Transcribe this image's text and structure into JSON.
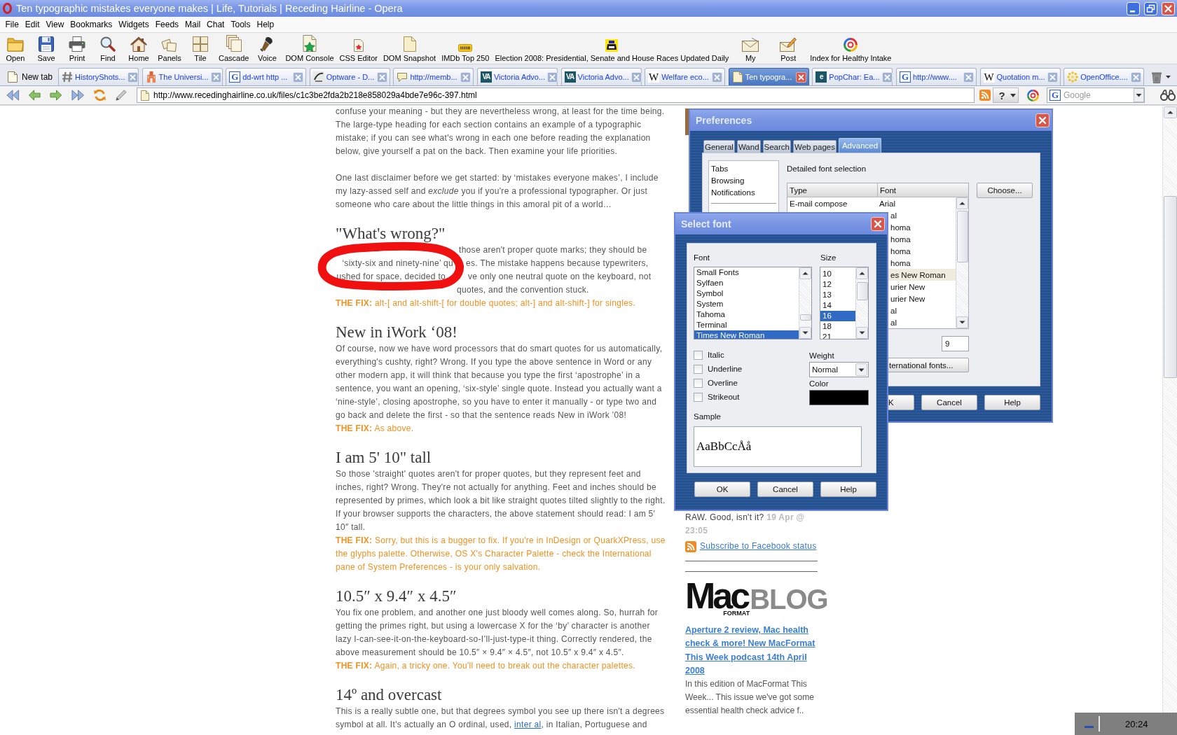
{
  "window": {
    "title": "Ten typographic mistakes everyone makes | Life, Tutorials | Receding Hairline - Opera"
  },
  "menu": [
    "File",
    "Edit",
    "View",
    "Bookmarks",
    "Widgets",
    "Feeds",
    "Mail",
    "Chat",
    "Tools",
    "Help"
  ],
  "toolbar": [
    {
      "label": "Open"
    },
    {
      "label": "Save"
    },
    {
      "label": "Print"
    },
    {
      "label": "Find"
    },
    {
      "label": "Home"
    },
    {
      "label": "Panels"
    },
    {
      "label": "Tile"
    },
    {
      "label": "Cascade"
    },
    {
      "label": "Voice"
    },
    {
      "label": "DOM Console"
    },
    {
      "label": "CSS Editor"
    },
    {
      "label": "DOM Snapshot"
    },
    {
      "label": "IMDb Top 250"
    },
    {
      "label": "Election 2008: Presidential, Senate and House Races Updated Daily"
    },
    {
      "label": "My"
    },
    {
      "label": "Post"
    },
    {
      "label": "Index for Healthy Intake"
    }
  ],
  "tabs": {
    "new_tab": "New tab",
    "items": [
      {
        "label": "HistoryShots...",
        "selected": false
      },
      {
        "label": "The Universi...",
        "selected": false
      },
      {
        "label": "dd-wrt http ...",
        "icon_text": "G",
        "selected": false
      },
      {
        "label": "Optware - D...",
        "selected": false
      },
      {
        "label": "http://memb...",
        "selected": false
      },
      {
        "label": "Victoria Advo...",
        "icon_text": "VA",
        "selected": false
      },
      {
        "label": "Victoria Advo...",
        "icon_text": "VA",
        "selected": false
      },
      {
        "label": "Welfare eco...",
        "icon_text": "W",
        "selected": false
      },
      {
        "label": "Ten typogra...",
        "selected": true
      },
      {
        "label": "PopChar: Ea...",
        "icon_text": "e",
        "selected": false
      },
      {
        "label": "http://www....",
        "icon_text": "G",
        "selected": false
      },
      {
        "label": "Quotation m...",
        "icon_text": "W",
        "selected": false
      },
      {
        "label": "OpenOffice....",
        "selected": false
      }
    ]
  },
  "address_bar": {
    "url": "http://www.recedinghairline.co.uk/files/c1c3be2fda2b218e858029a4bde7e96c-397.html",
    "help_button": "?",
    "search": {
      "engine_letter": "G",
      "placeholder": "Google"
    }
  },
  "article": {
    "intro": "confuse your meaning - but they are nevertheless wrong, at least for the time being. The large-type heading for each section contains an example of a typographic mistake; if you can see what's wrong in each one before reading the explanation below, give yourself a pat on the back. Then examine your life priorities.",
    "disclaimer": "One last disclaimer before we get started: by ‘mistakes everyone makes’, I include my lazy-assed self and *exclude* you if you're a professional typographer. Or just someone who care about the little things in this amoral pit of a world…",
    "sections": [
      {
        "kind": "annotated",
        "heading": "\"What's wrong?\"",
        "body": [
          {
            "kind": "text",
            "text": "those aren't proper quote marks; they should be"
          },
          {
            "kind": "text",
            "text": "‘sixty-six and ninety-nine’ qu"
          },
          {
            "kind": "text",
            "text": "es. The mistake happens because typewriters,"
          },
          {
            "kind": "text",
            "text": "ushed for space, decided to"
          },
          {
            "kind": "text",
            "text": "ve only one neutral quote on the keyboard, not"
          },
          {
            "kind": "text",
            "text": "quotes, and the convention stuck."
          }
        ],
        "fix": "**THE FIX:** alt-[ and alt-shift-[ for double quotes; alt-] and alt-shift-] for singles."
      },
      {
        "kind": "plain",
        "heading": "New in iWork ‘08!",
        "body": [
          {
            "kind": "text",
            "text": "Of course, now we have word processors that do smart quotes for us automatically, everything's cushty, right? Wrong. If you type the above sentence in Word or any other modern app, it will think that because you type the first ‘apostrophe’ in a sentence, you want an opening, ‘six-style’ single quote. Instead you actually want a ‘nine-style’, closing apostrophe, so you have to enter it manually - or type two and go back and delete the first - so that the sentence reads New in iWork ’08!"
          }
        ],
        "fix": "**THE FIX:** As above."
      },
      {
        "kind": "plain",
        "heading": "I am 5' 10\" tall",
        "body": [
          {
            "kind": "text",
            "text": "So those 'straight' quotes aren't for proper quotes, but they represent feet and inches, right? Wrong. They're not actually for anything. Feet and inches should be represented by primes, which look a bit like straight quotes tilted slightly to the right. If your browser supports the characters, the above statement should read: I am 5′ 10″ tall."
          }
        ],
        "fix": "**THE FIX:** Sorry, but this is a bugger to fix. If you're in InDesign or QuarkXPress, use the glyphs palette. Otherwise, OS X's Character Palette - check the International pane of System Preferences - is your only salvation."
      },
      {
        "kind": "plain",
        "heading": "10.5″ x 9.4″ x 4.5″",
        "body": [
          {
            "kind": "text",
            "text": "You fix one problem, and another one just bloody well comes along. So, hurrah for getting the primes right, but using a lowercase X for the ‘by’ character is another lazy I-can-see-it-on-the-keyboard-so-I’ll-just-type-it thing. Correctly rendered, the above measurement should be 10.5″ × 9.4″ × 4.5″, not 10.5″ x 9.4″ x 4.5″."
          }
        ],
        "fix": "**THE FIX:** Again, a tricky one. You'll need to break out the character palettes."
      },
      {
        "kind": "plain",
        "heading": "14º and overcast",
        "body": [
          {
            "kind": "text",
            "text": "This is a really subtle one, but that degrees symbol you see up there isn't a degrees symbol at all. It's actually an O ordinal, used, "
          },
          {
            "kind": "link",
            "text": "inter al"
          },
          {
            "kind": "text",
            "text": ", in Italian, Portuguese and"
          }
        ]
      }
    ]
  },
  "sidebar": {
    "status": "RAW. Good, isn't it? **19 Apr @ 23:05**",
    "subscribe_link": "Subscribe to Facebook status",
    "logo": {
      "main": "Mac",
      "accent": "BLOG",
      "sub": "FORMAT"
    },
    "post": {
      "title": "Aperture 2 review, Mac health check & more! New MacFormat This Week podcast 14th April 2008",
      "summary": "In this edition of MacFormat This Week... This issue we've got some essential health check advice f.."
    }
  },
  "preferences_dialog": {
    "title": "Preferences",
    "tabs": [
      {
        "label": "General",
        "selected": false
      },
      {
        "label": "Wand",
        "selected": false
      },
      {
        "label": "Search",
        "selected": false
      },
      {
        "label": "Web pages",
        "selected": false
      },
      {
        "label": "Advanced",
        "selected": true
      }
    ],
    "categories": [
      "Tabs",
      "Browsing",
      "Notifications"
    ],
    "section_title": "Detailed font selection",
    "columns": [
      "Type",
      "Font"
    ],
    "rows": [
      {
        "type": "E-mail compose",
        "font": "Arial",
        "selected": false
      },
      {
        "font": "al",
        "selected": false
      },
      {
        "font": "homa",
        "selected": false
      },
      {
        "font": "homa",
        "selected": false
      },
      {
        "font": "homa",
        "selected": false
      },
      {
        "font": "homa",
        "selected": false
      },
      {
        "font": "es New Roman",
        "selected": true
      },
      {
        "font": "urier New",
        "selected": false
      },
      {
        "font": "urier New",
        "selected": false
      },
      {
        "font": "al",
        "selected": false
      },
      {
        "font": "al",
        "selected": false
      }
    ],
    "choose_button": "Choose...",
    "size_value": "9",
    "international_button": "ternational fonts...",
    "buttons": [
      {
        "label": "K",
        "kind": "partial"
      },
      {
        "label": "Cancel",
        "kind": "full"
      },
      {
        "label": "Help",
        "kind": "full"
      }
    ]
  },
  "font_dialog": {
    "title": "Select font",
    "font_label": "Font",
    "size_label": "Size",
    "fonts": [
      {
        "name": "Small Fonts",
        "selected": false
      },
      {
        "name": "Sylfaen",
        "selected": false
      },
      {
        "name": "Symbol",
        "selected": false
      },
      {
        "name": "System",
        "selected": false
      },
      {
        "name": "Tahoma",
        "selected": false
      },
      {
        "name": "Terminal",
        "selected": false
      },
      {
        "name": "Times New Roman",
        "selected": true
      }
    ],
    "sizes": [
      {
        "value": "10",
        "selected": false
      },
      {
        "value": "12",
        "selected": false
      },
      {
        "value": "13",
        "selected": false
      },
      {
        "value": "14",
        "selected": false
      },
      {
        "value": "16",
        "selected": true
      },
      {
        "value": "18",
        "selected": false
      },
      {
        "value": "21",
        "selected": false
      }
    ],
    "styles": [
      {
        "label": "Italic",
        "checked": false
      },
      {
        "label": "Underline",
        "checked": false
      },
      {
        "label": "Overline",
        "checked": false
      },
      {
        "label": "Strikeout",
        "checked": false
      }
    ],
    "weight_label": "Weight",
    "weight": "Normal",
    "color_label": "Color",
    "color": "#000000",
    "sample_label": "Sample",
    "sample": "AaBbCcÅå",
    "buttons": [
      "OK",
      "Cancel",
      "Help"
    ]
  },
  "taskbar": {
    "clock": "20:24"
  }
}
